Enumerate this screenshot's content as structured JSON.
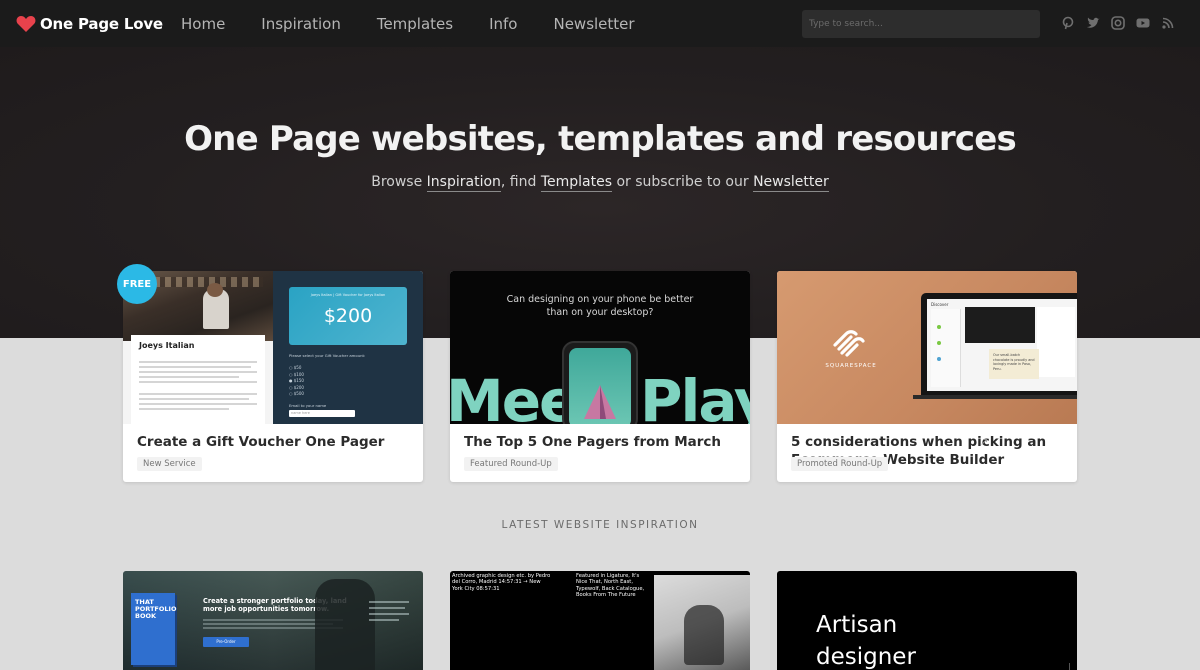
{
  "brand": {
    "name": "One Page Love",
    "accent": "#e8424c"
  },
  "nav": {
    "items": [
      "Home",
      "Inspiration",
      "Templates",
      "Info",
      "Newsletter"
    ],
    "search_placeholder": "Type to search...",
    "social_icons": [
      "pinterest-icon",
      "twitter-icon",
      "instagram-icon",
      "youtube-icon",
      "rss-icon"
    ]
  },
  "hero": {
    "title": "One Page websites, templates and resources",
    "sub_browse": "Browse",
    "sub_inspiration": "Inspiration",
    "sub_find": ", find",
    "sub_templates": "Templates",
    "sub_or": "or subscribe to our",
    "sub_newsletter": "Newsletter"
  },
  "featured": [
    {
      "badge": "FREE",
      "title": "Create a Gift Voucher One Pager",
      "tag": "New Service",
      "thumb": {
        "restaurant": "Joeys Italian",
        "voucher_header": "Joeys Italian | Gift Voucher for Joeys Italian",
        "amount": "$200",
        "select_label": "Please select your Gift Voucher amount:",
        "options": [
          "$50",
          "$100",
          "$150",
          "$200",
          "$500"
        ],
        "email_label": "Email to your name",
        "email_placeholder": "name here"
      }
    },
    {
      "title": "The Top 5 One Pagers from March",
      "tag": "Featured Round-Up",
      "thumb": {
        "question": "Can designing on your phone be better than on your desktop?",
        "big_text_left": "Mee",
        "big_text_right": "Play"
      }
    },
    {
      "title": "5 considerations when picking an Ecommerce Website Builder",
      "tag": "Promoted Round-Up",
      "thumb": {
        "brand": "SQUARESPACE",
        "screen_label": "Discover",
        "screen_note": "Our small-batch chocolate is proudly and lovingly made in Paso, Peru."
      }
    }
  ],
  "latest": {
    "label": "LATEST WEBSITE INSPIRATION",
    "items": [
      {
        "heading": "Create a stronger portfolio today, land more job opportunities tomorrow.",
        "book": "THAT PORTFOLIO BOOK",
        "cta": "Pre-Order"
      },
      {
        "text_left": "Archived graphic design etc. by Pedro del Corro, Madrid 14:57:31 → New York City 08:57:31",
        "text_right": "Featured in Ligature, It's Nice That, North East, Typewolf, Back Catalogue, Books From The Future"
      },
      {
        "heading_1": "Artisan",
        "heading_2": "designer"
      }
    ]
  }
}
